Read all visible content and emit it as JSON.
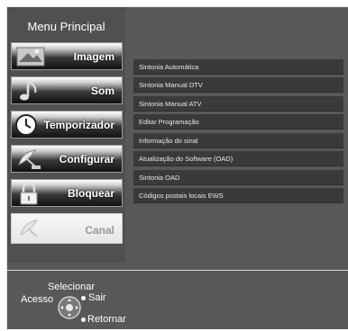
{
  "menu": {
    "title": "Menu Principal",
    "items": [
      {
        "label": "Imagem",
        "icon": "picture-icon"
      },
      {
        "label": "Som",
        "icon": "music-note-icon"
      },
      {
        "label": "Temporizador",
        "icon": "clock-icon"
      },
      {
        "label": "Configurar",
        "icon": "satellite-dish-icon"
      },
      {
        "label": "Bloquear",
        "icon": "padlock-icon"
      },
      {
        "label": "Canal",
        "icon": "channel-dish-icon"
      }
    ],
    "active": "Canal"
  },
  "submenu": {
    "items": [
      "Sintonia Automática",
      "Sintonia Manual DTV",
      "Sintonia Manual ATV",
      "Editar Programação",
      "Informação do sinal",
      "Atualização do Software (OAD)",
      "Sintonia OAD",
      "Códigos postais locais EWS"
    ]
  },
  "hints": {
    "select": "Selecionar",
    "access": "Acesso",
    "exit": "Sair",
    "return": "Retornar"
  }
}
